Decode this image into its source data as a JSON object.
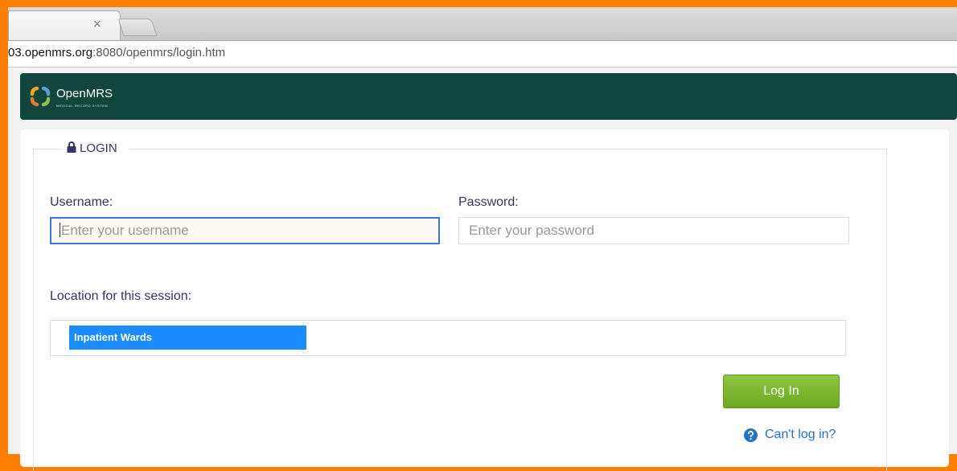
{
  "browser": {
    "tab_close_glyph": "×",
    "url_host": "03.openmrs.org",
    "url_rest": ":8080/openmrs/login.htm"
  },
  "header": {
    "logo_name": "OpenMRS",
    "logo_tagline": "MEDICAL RECORD SYSTEM",
    "logo_icon": "openmrs-logo-icon",
    "bg_color": "#12463d"
  },
  "login": {
    "legend": "LOGIN",
    "lock_icon": "lock-icon",
    "username_label": "Username:",
    "username_placeholder": "Enter your username",
    "username_value": "",
    "password_label": "Password:",
    "password_placeholder": "Enter your password",
    "password_value": "",
    "location_label": "Location for this session:",
    "locations": [
      "Inpatient Wards"
    ],
    "selected_location": "Inpatient Wards",
    "submit_label": "Log In",
    "help_link": "Can't log in?",
    "help_icon": "question-circle-icon"
  },
  "colors": {
    "accent": "#1a8cff",
    "button": "#7ab82e",
    "link": "#2274c7",
    "label": "#363463"
  }
}
